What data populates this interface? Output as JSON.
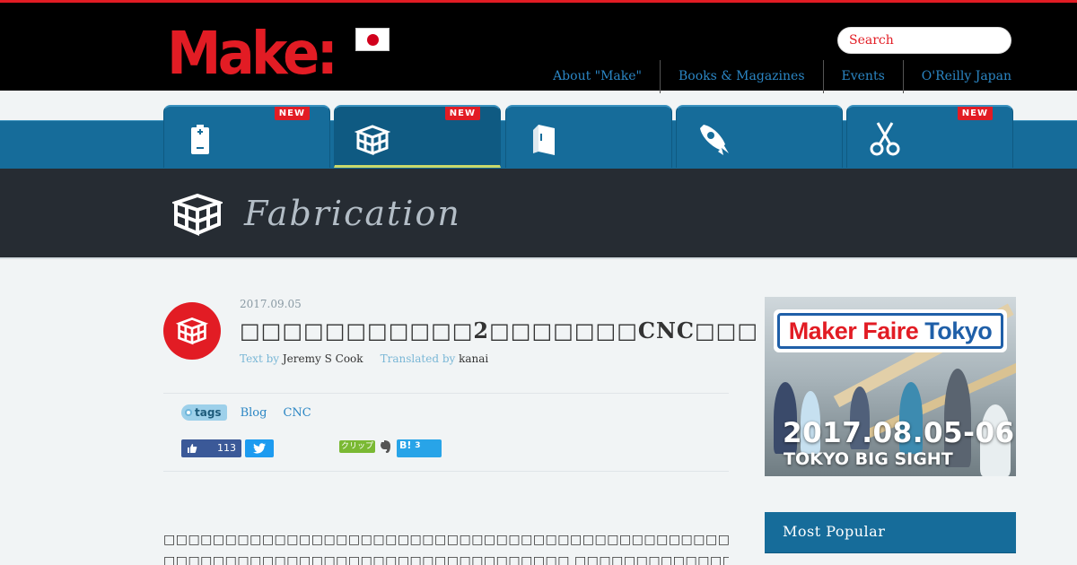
{
  "header": {
    "logo": "Make:",
    "search_placeholder": "Search",
    "nav": [
      "About \"Make\"",
      "Books & Magazines",
      "Events",
      "O'Reilly Japan"
    ]
  },
  "tabs": [
    {
      "icon": "battery-icon",
      "badge": "NEW"
    },
    {
      "icon": "blocks-icon",
      "badge": "NEW"
    },
    {
      "icon": "book-icon",
      "badge": ""
    },
    {
      "icon": "rocket-icon",
      "badge": ""
    },
    {
      "icon": "scissors-icon",
      "badge": "NEW"
    }
  ],
  "category": {
    "title": "Fabrication"
  },
  "article": {
    "date": "2017.09.05",
    "title": "□□□□□□□□□□□2□□□□□□□CNC□□□",
    "text_by_label": "Text by",
    "author": "Jeremy S Cook",
    "translated_by_label": "Translated by",
    "translator": "kanai",
    "tags_label": "tags",
    "tags": [
      "Blog",
      "CNC"
    ],
    "fb_count": "113",
    "clip_label": "クリップ",
    "hatena_label": "B!",
    "hatena_count": "3",
    "body_line1": "□□□□□□□□□□□□□□□□□□□□□□□□□□□□□□□□□□□□□□□□□□□□□□□□□□□□□□□□□□□□□□□□□□□□",
    "body_line2": "□□□□□□□□□□□□□□□□□□□□□□□□□□□□□□□□□ □□□□□□□□□□□□□□□□□□□□□□□□□Barton Dring□□"
  },
  "sidebar": {
    "ad_brand_red": "Maker Faire",
    "ad_brand_blue": "Tokyo",
    "ad_date": "2017.08.05-06",
    "ad_venue": "TOKYO BIG SIGHT",
    "popular_title": "Most Popular"
  },
  "colors": {
    "brand_red": "#e21c24",
    "nav_blue": "#166c9a",
    "link_blue": "#2b86c4"
  }
}
